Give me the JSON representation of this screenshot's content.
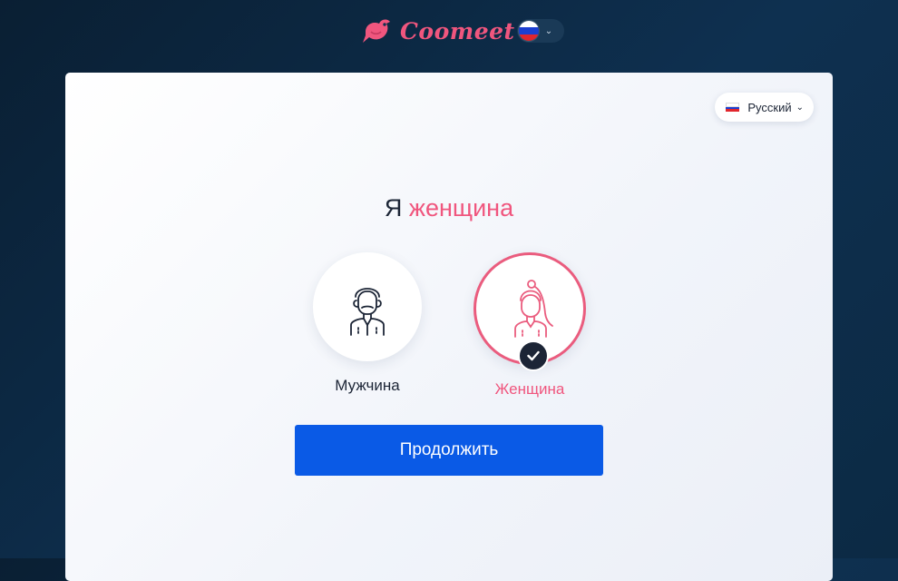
{
  "header": {
    "logo_text": "Coomeet",
    "logo_icon": "bird-logo-icon",
    "language_button_icon": "russia-flag-icon"
  },
  "card": {
    "language_selector": {
      "label": "Русский",
      "icon": "russia-flag-icon"
    },
    "heading": {
      "prefix": "Я",
      "accent": "женщина"
    },
    "options": [
      {
        "label": "Мужчина",
        "icon": "male-avatar-icon",
        "selected": false
      },
      {
        "label": "Женщина",
        "icon": "female-avatar-icon",
        "selected": true
      }
    ],
    "continue_label": "Продолжить"
  },
  "colors": {
    "accent_pink": "#f0567e",
    "primary_blue": "#0a5ae6",
    "dark_text": "#1c2536",
    "background_dark": "#0e3050"
  }
}
